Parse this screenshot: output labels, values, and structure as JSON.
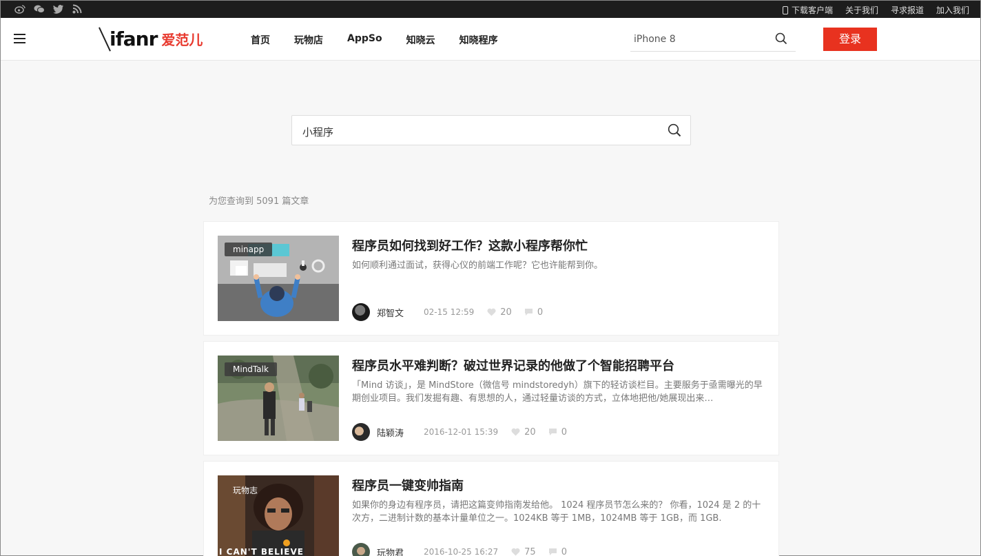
{
  "topbar": {
    "social_icons": [
      "weibo-icon",
      "wechat-icon",
      "twitter-icon",
      "rss-icon"
    ],
    "links": [
      "下载客户端",
      "关于我们",
      "寻求报道",
      "加入我们"
    ]
  },
  "header": {
    "logo_en": "ifanr",
    "logo_cn": "爱范儿",
    "nav": [
      "首页",
      "玩物店",
      "AppSo",
      "知晓云",
      "知晓程序"
    ],
    "search_value": "iPhone 8",
    "login_label": "登录"
  },
  "search": {
    "query": "小程序"
  },
  "results": {
    "count_text": "为您查询到 5091 篇文章",
    "items": [
      {
        "tag": "minapp",
        "title": "程序员如何找到好工作？这款小程序帮你忙",
        "desc": "如何顺利通过面试，获得心仪的前端工作呢？它也许能帮到你。",
        "author": "郑智文",
        "date": "02-15 12:59",
        "likes": "20",
        "comments": "0"
      },
      {
        "tag": "MindTalk",
        "title": "程序员水平难判断？破过世界记录的他做了个智能招聘平台",
        "desc": "「Mind 访谈」，是 MindStore（微信号 mindstoredyh）旗下的轻访谈栏目。主要服务于亟需曝光的早期创业项目。我们发掘有趣、有思想的人，通过轻量访谈的方式，立体地把他/她展现出来…",
        "author": "陆颖涛",
        "date": "2016-12-01 15:39",
        "likes": "20",
        "comments": "0"
      },
      {
        "tag": "玩物志",
        "title": "程序员一键变帅指南",
        "desc": "如果你的身边有程序员，请把这篇变帅指南发给他。 1024 程序员节怎么来的？ 你看，1024 是 2 的十次方，二进制计数的基本计量单位之一。1024KB 等于 1MB，1024MB 等于 1GB，而 1GB.",
        "author": "玩物君",
        "date": "2016-10-25 16:27",
        "likes": "75",
        "comments": "0",
        "thumb_caption": "I CAN'T BELIEVE"
      }
    ]
  },
  "colors": {
    "accent": "#e8321f",
    "topbar_bg": "#1d1d1d",
    "page_bg": "#f7f7f7"
  }
}
